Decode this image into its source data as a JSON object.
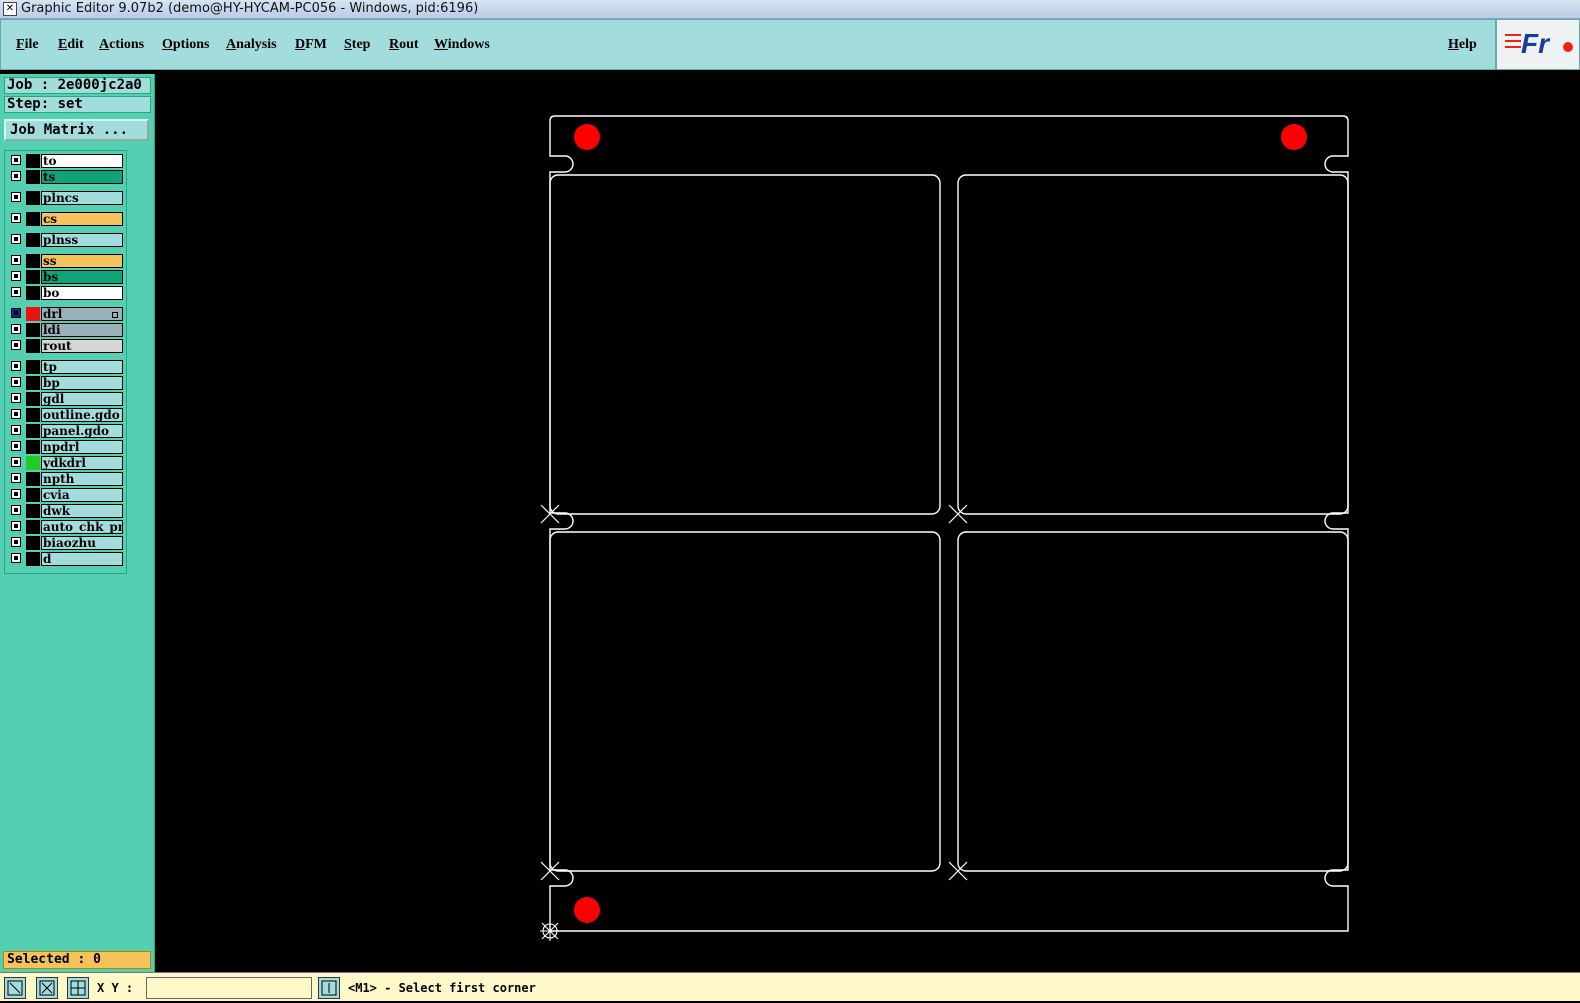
{
  "window": {
    "title": "Graphic Editor 9.07b2 (demo@HY-HYCAM-PC056 - Windows, pid:6196)"
  },
  "menu": {
    "items": [
      "File",
      "Edit",
      "Actions",
      "Options",
      "Analysis",
      "DFM",
      "Step",
      "Rout",
      "Windows"
    ],
    "help": "Help"
  },
  "logo": {
    "text": "Fr"
  },
  "job": {
    "label": "Job : 2e000jc2a0"
  },
  "step": {
    "label": "Step: set"
  },
  "job_matrix": {
    "label": "Job Matrix ..."
  },
  "layers": [
    {
      "name": "to",
      "color": "#ffffff",
      "swatch": "#000000"
    },
    {
      "name": "ts",
      "color": "#10a37a",
      "swatch": "#000000"
    },
    {
      "name": "plncs",
      "color": "#a3dcdc",
      "swatch": "#000000"
    },
    {
      "name": "cs",
      "color": "#f6c25b",
      "swatch": "#000000"
    },
    {
      "name": "plnss",
      "color": "#a3dcdc",
      "swatch": "#000000"
    },
    {
      "name": "ss",
      "color": "#f6c25b",
      "swatch": "#000000"
    },
    {
      "name": "bs",
      "color": "#10a37a",
      "swatch": "#000000"
    },
    {
      "name": "bo",
      "color": "#ffffff",
      "swatch": "#000000"
    },
    {
      "name": "drl",
      "color": "#9cb0ba",
      "swatch": "#ee1111",
      "active": true
    },
    {
      "name": "ldi",
      "color": "#9cb0ba",
      "swatch": "#000000"
    },
    {
      "name": "rout",
      "color": "#d6d6d6",
      "swatch": "#000000"
    },
    {
      "name": "tp",
      "color": "#a3dcdc",
      "swatch": "#000000"
    },
    {
      "name": "bp",
      "color": "#a3dcdc",
      "swatch": "#000000"
    },
    {
      "name": "gdl",
      "color": "#a3dcdc",
      "swatch": "#000000"
    },
    {
      "name": "outline.gdo",
      "color": "#a3dcdc",
      "swatch": "#000000"
    },
    {
      "name": "panel.gdo",
      "color": "#a3dcdc",
      "swatch": "#000000"
    },
    {
      "name": "npdrl",
      "color": "#a3dcdc",
      "swatch": "#000000"
    },
    {
      "name": "ydkdrl",
      "color": "#a3dcdc",
      "swatch": "#22cc22"
    },
    {
      "name": "npth",
      "color": "#a3dcdc",
      "swatch": "#000000"
    },
    {
      "name": "cvia",
      "color": "#a3dcdc",
      "swatch": "#000000"
    },
    {
      "name": "dwk",
      "color": "#a3dcdc",
      "swatch": "#000000"
    },
    {
      "name": "auto_chk_pn",
      "color": "#a3dcdc",
      "swatch": "#000000"
    },
    {
      "name": "biaozhu",
      "color": "#a3dcdc",
      "swatch": "#000000"
    },
    {
      "name": "d",
      "color": "#a3dcdc",
      "swatch": "#000000"
    }
  ],
  "selected": {
    "label": "Selected : 0"
  },
  "status": {
    "xy_label": "X Y :",
    "prompt": "<M1> - Select first corner"
  },
  "colors": {
    "board_outline": "#ffffff",
    "drill_hole": "#ff0000",
    "canvas_bg": "#000000"
  }
}
